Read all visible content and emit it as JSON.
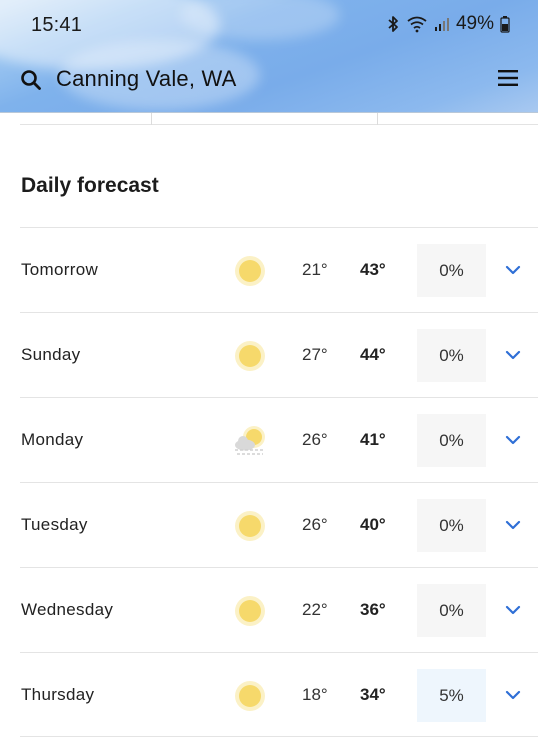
{
  "status_bar": {
    "time": "15:41",
    "battery": "49%"
  },
  "header": {
    "location": "Canning Vale, WA"
  },
  "section": {
    "title": "Daily forecast"
  },
  "days": [
    {
      "day": "Tomorrow",
      "icon": "sun-icon",
      "low": "21°",
      "high": "43°",
      "precip": "0%"
    },
    {
      "day": "Sunday",
      "icon": "sun-icon",
      "low": "27°",
      "high": "44°",
      "precip": "0%"
    },
    {
      "day": "Monday",
      "icon": "sun-cloud-haze-icon",
      "low": "26°",
      "high": "41°",
      "precip": "0%"
    },
    {
      "day": "Tuesday",
      "icon": "sun-icon",
      "low": "26°",
      "high": "40°",
      "precip": "0%"
    },
    {
      "day": "Wednesday",
      "icon": "sun-icon",
      "low": "22°",
      "high": "36°",
      "precip": "0%"
    },
    {
      "day": "Thursday",
      "icon": "sun-icon",
      "low": "18°",
      "high": "34°",
      "precip": "5%"
    }
  ],
  "colors": {
    "accent": "#2f6fd6",
    "sun": "#f6d96b",
    "sun_glow": "#fbeeb4",
    "header_sky": "#79acea"
  }
}
